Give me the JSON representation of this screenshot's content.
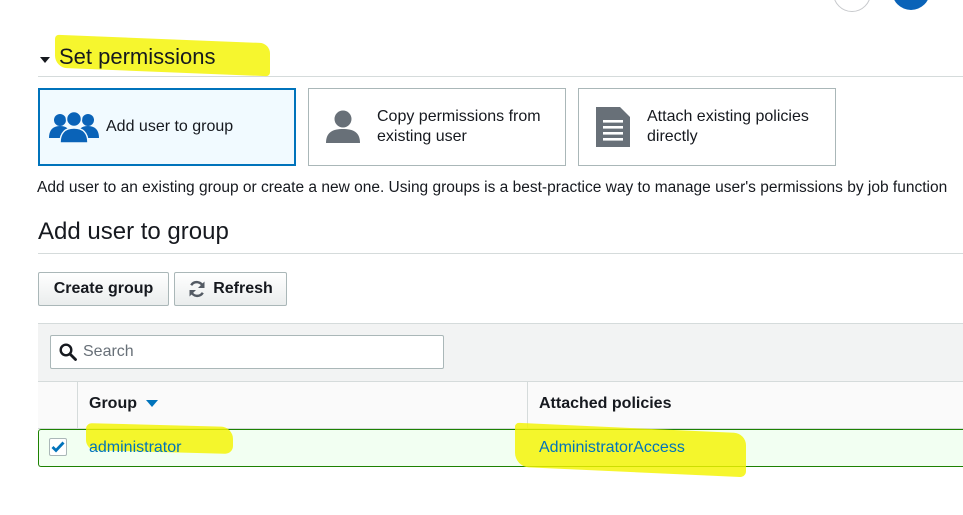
{
  "section": {
    "title": "Set permissions"
  },
  "options": [
    {
      "label": "Add user to group",
      "icon": "users-group-icon",
      "selected": true
    },
    {
      "label": "Copy permissions from existing user",
      "icon": "user-icon",
      "selected": false
    },
    {
      "label": "Attach existing policies directly",
      "icon": "document-icon",
      "selected": false
    }
  ],
  "description": "Add user to an existing group or create a new one. Using groups is a best-practice way to manage user's permissions by job function",
  "group_section": {
    "title": "Add user to group",
    "create_button": "Create group",
    "refresh_button": "Refresh"
  },
  "search": {
    "placeholder": "Search"
  },
  "table": {
    "columns": [
      "Group",
      "Attached policies"
    ],
    "sort_column": "Group",
    "rows": [
      {
        "checked": true,
        "group": "administrator",
        "policies": "AdministratorAccess"
      }
    ]
  },
  "colors": {
    "accent": "#0073bb",
    "highlight": "#f4f400",
    "selected_row_border": "#1d8102"
  }
}
